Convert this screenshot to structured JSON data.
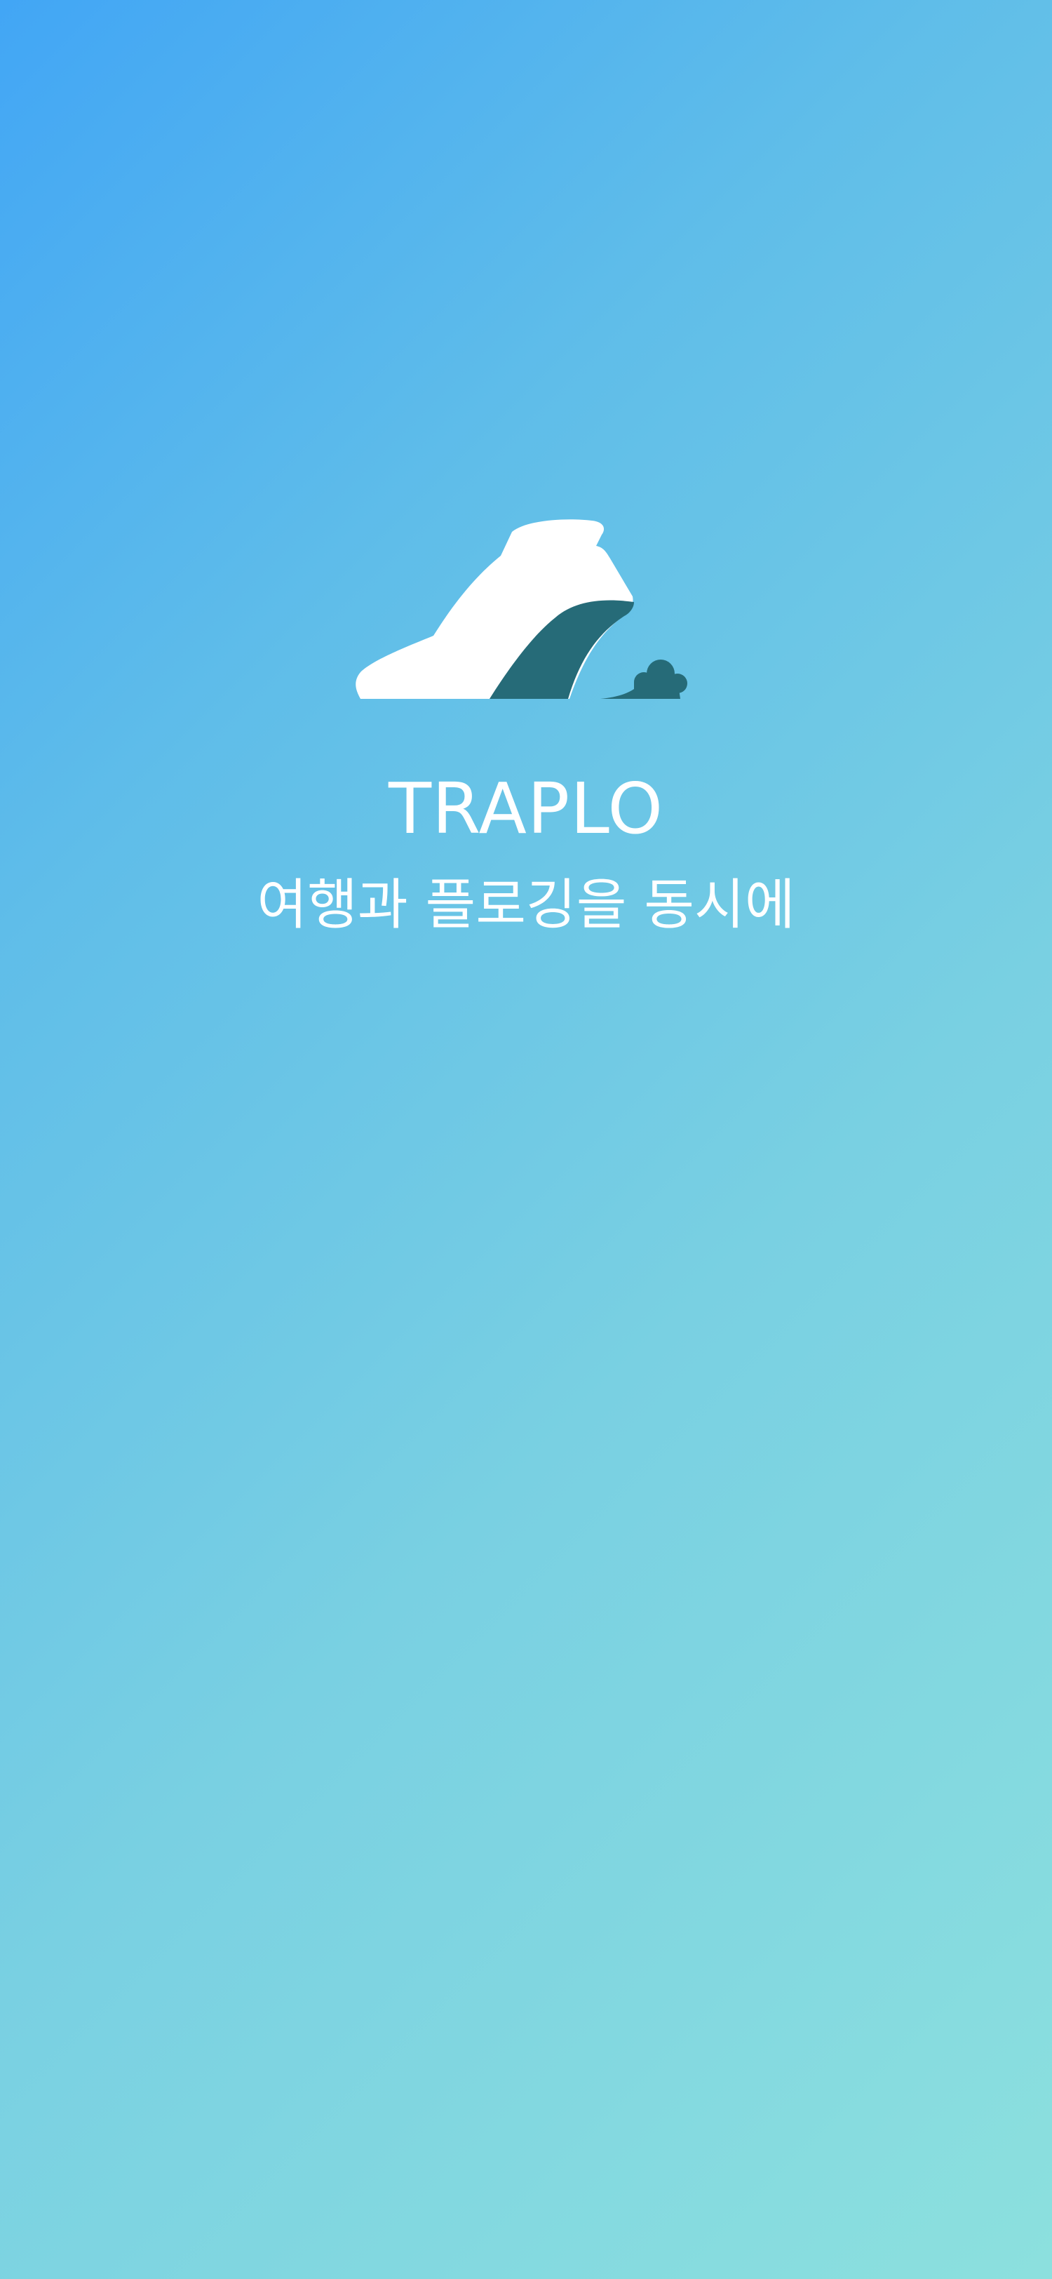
{
  "app": {
    "name": "TRAPLO",
    "tagline": "여행과 플로깅을 동시에"
  },
  "logo": {
    "icon": "shoe-icon",
    "accent_icon": "trash-bag-icon"
  },
  "colors": {
    "gradient_start": "#42a6f5",
    "gradient_mid": "#79d0e2",
    "gradient_end": "#8ce0de",
    "logo_primary": "#ffffff",
    "logo_accent": "#266b78",
    "text": "#ffffff"
  }
}
